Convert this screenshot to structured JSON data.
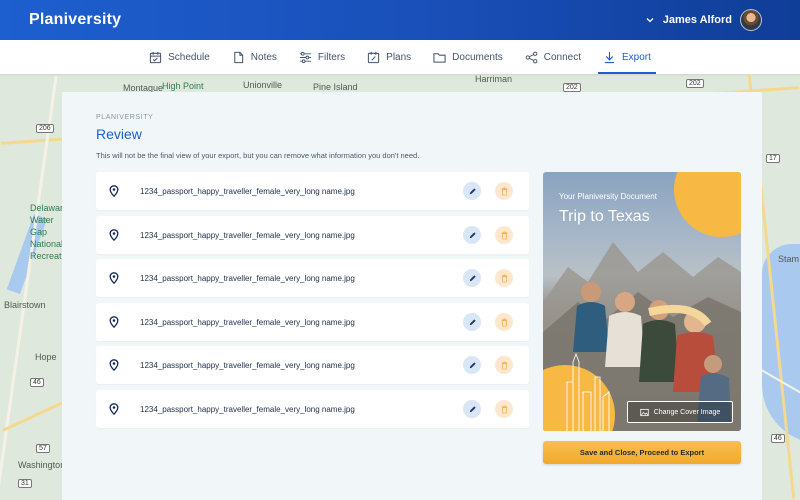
{
  "app": {
    "name": "Planiversity"
  },
  "user": {
    "name": "James Alford",
    "menu_icon": "chevron-down-icon"
  },
  "nav": {
    "items": [
      {
        "label": "Schedule",
        "icon": "calendar-icon"
      },
      {
        "label": "Notes",
        "icon": "note-icon"
      },
      {
        "label": "Filters",
        "icon": "sliders-icon"
      },
      {
        "label": "Plans",
        "icon": "plans-icon"
      },
      {
        "label": "Documents",
        "icon": "folder-icon"
      },
      {
        "label": "Connect",
        "icon": "share-icon"
      },
      {
        "label": "Export",
        "icon": "download-icon",
        "active": true
      }
    ]
  },
  "map": {
    "labels": [
      "Harriman",
      "Montague",
      "High Point",
      "Unionville",
      "Pine Island",
      "Delaware Water Gap National Recreation",
      "Blairstown",
      "Hope",
      "Washington",
      "Stam"
    ],
    "shields": [
      "202",
      "202",
      "206",
      "17",
      "46",
      "46",
      "31",
      "57"
    ]
  },
  "review": {
    "eyebrow": "PLANIVERSITY",
    "title": "Review",
    "description": "This will not be the final view of your export, but you can remove what information you don't need.",
    "files": [
      {
        "name": "1234_passport_happy_traveller_female_very_long name.jpg"
      },
      {
        "name": "1234_passport_happy_traveller_female_very_long name.jpg"
      },
      {
        "name": "1234_passport_happy_traveller_female_very_long name.jpg"
      },
      {
        "name": "1234_passport_happy_traveller_female_very_long name.jpg"
      },
      {
        "name": "1234_passport_happy_traveller_female_very_long name.jpg"
      },
      {
        "name": "1234_passport_happy_traveller_female_very_long name.jpg"
      }
    ]
  },
  "cover": {
    "subtitle": "Your Planiversity Document",
    "title": "Trip to Texas",
    "change_label": "Change Cover Image"
  },
  "actions": {
    "save_label": "Save and Close, Proceed to Export"
  },
  "colors": {
    "primary": "#1d5fcf",
    "accent": "#f7b944",
    "panel_bg": "#f1f6f9"
  }
}
